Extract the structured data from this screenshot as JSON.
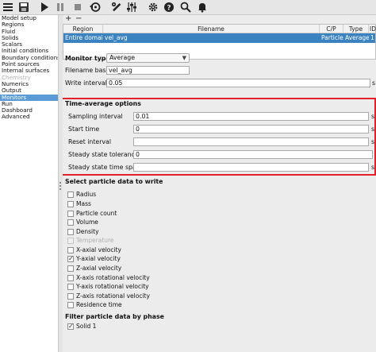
{
  "toolbar": {
    "icons": [
      "menu-icon",
      "save-icon",
      "play-icon",
      "pause-icon",
      "stop-icon",
      "restore-icon",
      "wrench-icon",
      "sliders-icon",
      "gear-icon",
      "help-icon",
      "search-icon",
      "bell-icon"
    ]
  },
  "sidebar": {
    "items": [
      {
        "label": "Model setup",
        "state": "normal"
      },
      {
        "label": "Regions",
        "state": "normal"
      },
      {
        "label": "Fluid",
        "state": "normal"
      },
      {
        "label": "Solids",
        "state": "normal"
      },
      {
        "label": "Scalars",
        "state": "normal"
      },
      {
        "label": "Initial conditions",
        "state": "normal"
      },
      {
        "label": "Boundary conditions",
        "state": "normal"
      },
      {
        "label": "Point sources",
        "state": "normal"
      },
      {
        "label": "Internal surfaces",
        "state": "normal"
      },
      {
        "label": "Chemistry",
        "state": "disabled"
      },
      {
        "label": "Numerics",
        "state": "normal"
      },
      {
        "label": "Output",
        "state": "normal"
      },
      {
        "label": "Monitors",
        "state": "selected"
      },
      {
        "label": "Run",
        "state": "normal"
      },
      {
        "label": "Dashboard",
        "state": "normal"
      },
      {
        "label": "Advanced",
        "state": "normal"
      }
    ]
  },
  "main": {
    "add_label": "+",
    "remove_label": "−",
    "table": {
      "headers": [
        "Region",
        "Filename",
        "C/P",
        "Type",
        "ID"
      ],
      "rows": [
        [
          "Entire domain",
          "vel_avg",
          "Particle",
          "Average",
          "1"
        ]
      ]
    },
    "monitor_type": {
      "label": "Monitor type",
      "value": "Average"
    },
    "filename_base": {
      "label": "Filename base",
      "value": "vel_avg"
    },
    "write_interval": {
      "label": "Write interval",
      "value": "0.05",
      "unit": "s"
    },
    "time_average": {
      "title": "Time-average options",
      "fields": [
        {
          "label": "Sampling interval",
          "value": "0.01",
          "unit": "s"
        },
        {
          "label": "Start time",
          "value": "0",
          "unit": "s"
        },
        {
          "label": "Reset interval",
          "value": "",
          "unit": "s"
        },
        {
          "label": "Steady state tolerance",
          "value": "0",
          "unit": ""
        },
        {
          "label": "Steady state time span",
          "value": "",
          "unit": "s"
        }
      ]
    },
    "particle_data": {
      "title": "Select particle data to write",
      "items": [
        {
          "label": "Radius",
          "checked": false,
          "disabled": false
        },
        {
          "label": "Mass",
          "checked": false,
          "disabled": false
        },
        {
          "label": "Particle count",
          "checked": false,
          "disabled": false
        },
        {
          "label": "Volume",
          "checked": false,
          "disabled": false
        },
        {
          "label": "Density",
          "checked": false,
          "disabled": false
        },
        {
          "label": "Temperature",
          "checked": false,
          "disabled": true
        },
        {
          "label": "X-axial velocity",
          "checked": false,
          "disabled": false
        },
        {
          "label": "Y-axial velocity",
          "checked": true,
          "disabled": false
        },
        {
          "label": "Z-axial velocity",
          "checked": false,
          "disabled": false
        },
        {
          "label": "X-axis rotational velocity",
          "checked": false,
          "disabled": false
        },
        {
          "label": "Y-axis rotational velocity",
          "checked": false,
          "disabled": false
        },
        {
          "label": "Z-axis rotational velocity",
          "checked": false,
          "disabled": false
        },
        {
          "label": "Residence time",
          "checked": false,
          "disabled": false
        }
      ]
    },
    "phase_filter": {
      "title": "Filter particle data by phase",
      "items": [
        {
          "label": "Solid 1",
          "checked": true,
          "disabled": false
        }
      ]
    }
  },
  "colors": {
    "selection": "#3b83c0",
    "sidebar_selected": "#5b9bd5",
    "highlight_box": "#e0202a"
  }
}
